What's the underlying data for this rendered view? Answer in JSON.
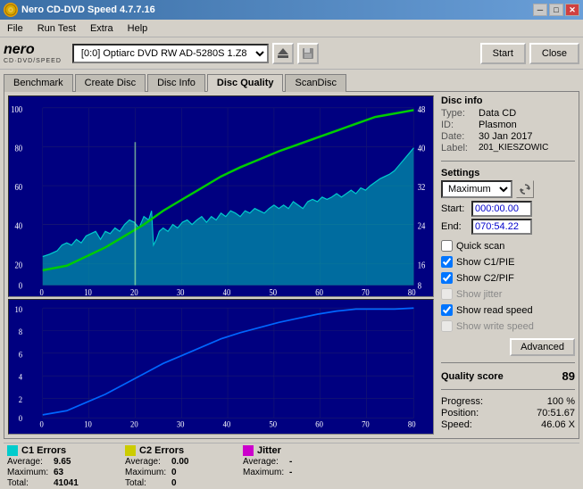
{
  "window": {
    "title": "Nero CD-DVD Speed 4.7.7.16",
    "icon": "CD"
  },
  "titlebar": {
    "minimize": "─",
    "maximize": "□",
    "close": "✕"
  },
  "menu": {
    "items": [
      "File",
      "Run Test",
      "Extra",
      "Help"
    ]
  },
  "toolbar": {
    "logo": "nero",
    "logo_sub": "CD·DVD/SPEED",
    "drive": "[0:0]  Optiarc DVD RW AD-5280S 1.Z8",
    "start_label": "Start",
    "close_label": "Close"
  },
  "tabs": {
    "items": [
      "Benchmark",
      "Create Disc",
      "Disc Info",
      "Disc Quality",
      "ScanDisc"
    ],
    "active": "Disc Quality"
  },
  "disc_info": {
    "section": "Disc info",
    "type_label": "Type:",
    "type_value": "Data CD",
    "id_label": "ID:",
    "id_value": "Plasmon",
    "date_label": "Date:",
    "date_value": "30 Jan 2017",
    "label_label": "Label:",
    "label_value": "201_KIESZOWIC"
  },
  "settings": {
    "section": "Settings",
    "speed_value": "Maximum",
    "start_label": "Start:",
    "start_value": "000:00.00",
    "end_label": "End:",
    "end_value": "070:54.22"
  },
  "checkboxes": {
    "quick_scan": {
      "label": "Quick scan",
      "checked": false,
      "enabled": true
    },
    "show_c1_pie": {
      "label": "Show C1/PIE",
      "checked": true,
      "enabled": true
    },
    "show_c2_pif": {
      "label": "Show C2/PIF",
      "checked": true,
      "enabled": true
    },
    "show_jitter": {
      "label": "Show jitter",
      "checked": false,
      "enabled": false
    },
    "show_read_speed": {
      "label": "Show read speed",
      "checked": true,
      "enabled": true
    },
    "show_write_speed": {
      "label": "Show write speed",
      "checked": false,
      "enabled": false
    }
  },
  "advanced_btn": "Advanced",
  "quality": {
    "label": "Quality score",
    "value": "89"
  },
  "progress": {
    "label": "Progress:",
    "value": "100 %",
    "position_label": "Position:",
    "position_value": "70:51.67",
    "speed_label": "Speed:",
    "speed_value": "46.06 X"
  },
  "legend": {
    "c1": {
      "label": "C1 Errors",
      "color": "#00cccc",
      "avg_label": "Average:",
      "avg_value": "9.65",
      "max_label": "Maximum:",
      "max_value": "63",
      "total_label": "Total:",
      "total_value": "41041"
    },
    "c2": {
      "label": "C2 Errors",
      "color": "#cccc00",
      "avg_label": "Average:",
      "avg_value": "0.00",
      "max_label": "Maximum:",
      "max_value": "0",
      "total_label": "Total:",
      "total_value": "0"
    },
    "jitter": {
      "label": "Jitter",
      "color": "#cc00cc",
      "avg_label": "Average:",
      "avg_value": "-",
      "max_label": "Maximum:",
      "max_value": "-",
      "total_label": "",
      "total_value": ""
    }
  },
  "chart_top": {
    "y_max": 100,
    "x_max": 80,
    "y_labels": [
      "100",
      "80",
      "60",
      "40",
      "20",
      "0"
    ],
    "x_labels": [
      "0",
      "10",
      "20",
      "30",
      "40",
      "50",
      "60",
      "70",
      "80"
    ],
    "right_labels": [
      "48",
      "40",
      "32",
      "24",
      "16",
      "8"
    ]
  },
  "chart_bottom": {
    "y_max": 10,
    "x_max": 80,
    "y_labels": [
      "10",
      "8",
      "6",
      "4",
      "2",
      "0"
    ],
    "x_labels": [
      "0",
      "10",
      "20",
      "30",
      "40",
      "50",
      "60",
      "70",
      "80"
    ]
  }
}
